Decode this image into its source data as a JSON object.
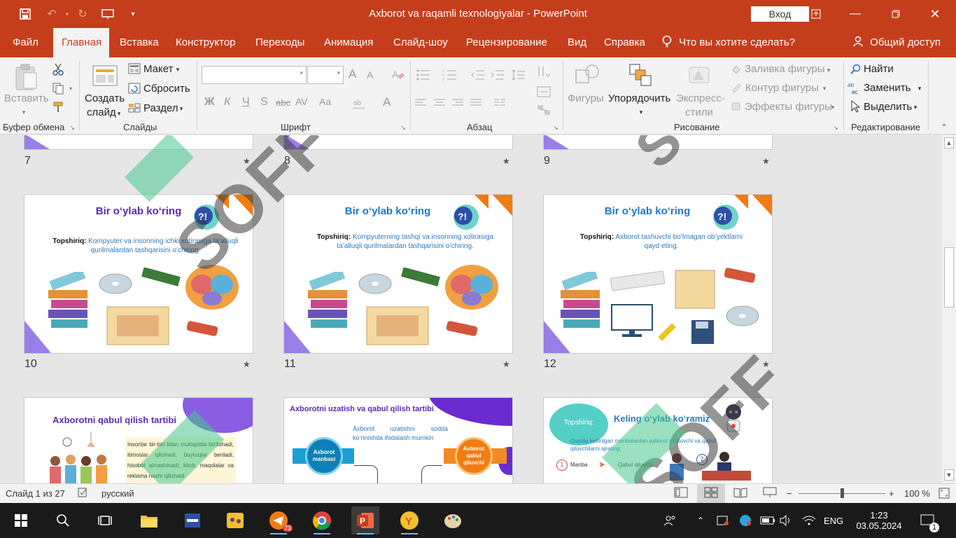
{
  "window": {
    "title": "Axborot va raqamli texnologiyalar  -  PowerPoint",
    "login_label": "Вход"
  },
  "menu": {
    "tabs": [
      "Файл",
      "Главная",
      "Вставка",
      "Конструктор",
      "Переходы",
      "Анимация",
      "Слайд-шоу",
      "Рецензирование",
      "Вид",
      "Справка"
    ],
    "active_tab": "Главная",
    "tell_me": "Что вы хотите сделать?",
    "share": "Общий доступ"
  },
  "ribbon": {
    "clipboard": {
      "paste": "Вставить",
      "group": "Буфер обмена"
    },
    "slides": {
      "new_slide_line1": "Создать",
      "new_slide_line2": "слайд",
      "layout": "Макет",
      "reset": "Сбросить",
      "section": "Раздел",
      "group": "Слайды"
    },
    "font": {
      "group": "Шрифт",
      "bold": "Ж",
      "italic": "К",
      "underline": "Ч",
      "shadow": "S",
      "strike": "abc",
      "spacing": "AV",
      "case": "Aa",
      "grow": "A",
      "shrink": "A",
      "clear": "A"
    },
    "paragraph": {
      "group": "Абзац"
    },
    "drawing": {
      "shapes": "Фигуры",
      "arrange": "Упорядочить",
      "quick_styles_line1": "Экспресс-",
      "quick_styles_line2": "стили",
      "fill": "Заливка фигуры",
      "outline": "Контур фигуры",
      "effects": "Эффекты фигуры",
      "group": "Рисование"
    },
    "editing": {
      "find": "Найти",
      "replace": "Заменить",
      "select": "Выделить",
      "group": "Редактирование"
    }
  },
  "slides": {
    "row1_numbers": [
      "7",
      "8",
      "9"
    ],
    "row2": [
      {
        "number": "10",
        "title": "Bir o‘ylab ko‘ring",
        "task_label": "Topshiriq:",
        "task_text": "Kompyuter va insonning ichki xotirasiga ta’alluqli qurilmalardan tashqarisini o‘chiring."
      },
      {
        "number": "11",
        "title": "Bir o‘ylab ko‘ring",
        "task_label": "Topshiriq:",
        "task_text": "Kompyuterning tashqi va insonning xotirasiga ta’alluqli qurilmalardan tashqarisini o‘chiring."
      },
      {
        "number": "12",
        "title": "Bir o‘ylab ko‘ring",
        "task_label": "Topshiriq:",
        "task_text": "Axborot tashuvchi bo‘lmagan ob’yektlarni qayd eting."
      }
    ],
    "row3": [
      {
        "title": "Axborotni qabul qilish tartibi",
        "body": "Insonlar bir-biri bilan muloqotda bo‘lishadi, itimoslar qilishadi, buyruqlar beriladi, hisobot almashinadi, kitob, maqolalar va reklama nashr qilishadi."
      },
      {
        "title": "Axborotni uzatish va qabul qilish tartibi",
        "body": "Axborot uzatishni sodda ko‘rinishda ifodalash mumkin",
        "source": "Axborot manbasi",
        "receiver": "Axborot qabul qiluvchi"
      },
      {
        "badge": "Topshiriq:",
        "title": "Keling o‘ylab ko‘ramiz",
        "body": "Quyida keltirilgan manbalardan axborot uzatuvchi va qabul qiluvchilarni ajrating:",
        "col1": "Manba",
        "col2": "Qabul qiluvchi",
        "n1": "1",
        "n2": "2"
      }
    ]
  },
  "statusbar": {
    "slide_info": "Слайд 1 из 27",
    "language": "русский",
    "zoom": "100 %"
  },
  "taskbar": {
    "telegram_badge": "73",
    "lang": "ENG",
    "time": "1:23",
    "date": "03.05.2024",
    "notif_count": "1"
  },
  "watermark": {
    "text": "SOFF"
  },
  "colors": {
    "accent": "#c43e1c",
    "title_purple": "#5a2bb5",
    "title_blue": "#1f78c8",
    "slide_orange": "#f07c12",
    "slide_purple": "#9a7ee8"
  }
}
